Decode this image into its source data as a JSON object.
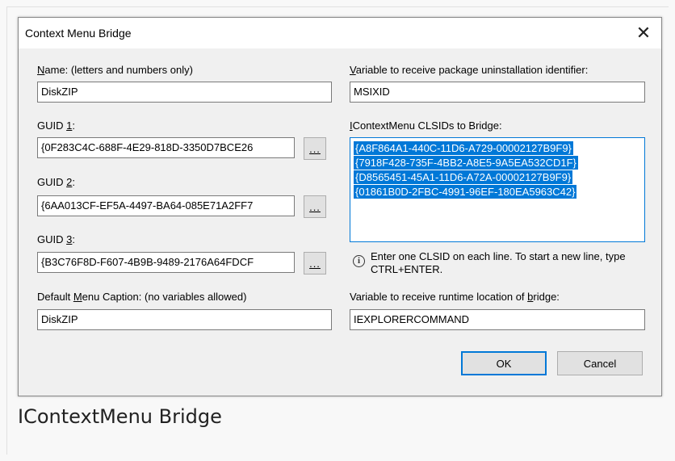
{
  "dialog": {
    "title": "Context Menu Bridge",
    "close_glyph": "✕"
  },
  "name_field": {
    "label_pre": "",
    "label_access": "N",
    "label_post": "ame: (letters and numbers only)",
    "value": "DiskZIP"
  },
  "variable_uninstall": {
    "label_pre": "",
    "label_access": "V",
    "label_post": "ariable to receive package uninstallation identifier:",
    "value": "MSIXID"
  },
  "guid1": {
    "label_pre": "GUID ",
    "label_access": "1",
    "label_post": ":",
    "value": "{0F283C4C-688F-4E29-818D-3350D7BCE26"
  },
  "guid2": {
    "label_pre": "GUID ",
    "label_access": "2",
    "label_post": ":",
    "value": "{6AA013CF-EF5A-4497-BA64-085E71A2FF7"
  },
  "guid3": {
    "label_pre": "GUID ",
    "label_access": "3",
    "label_post": ":",
    "value": "{B3C76F8D-F607-4B9B-9489-2176A64FDCF"
  },
  "browse_label": "...",
  "clsids": {
    "label_pre": "",
    "label_access": "I",
    "label_post": "ContextMenu CLSIDs to Bridge:",
    "lines": [
      "{A8F864A1-440C-11D6-A729-00002127B9F9}",
      "{7918F428-735F-4BB2-A8E5-9A5EA532CD1F}",
      "{D8565451-45A1-11D6-A72A-00002127B9F9}",
      "{01861B0D-2FBC-4991-96EF-180EA5963C42}"
    ]
  },
  "hint": {
    "icon": "info-icon",
    "text": "Enter one CLSID on each line. To start a new line, type CTRL+ENTER."
  },
  "menu_caption": {
    "label_pre": "Default ",
    "label_access": "M",
    "label_post": "enu Caption: (no variables allowed)",
    "value": "DiskZIP"
  },
  "runtime_location": {
    "label_pre": "Variable to receive runtime location of ",
    "label_access": "b",
    "label_post": "ridge:",
    "value": "IEXPLORERCOMMAND"
  },
  "buttons": {
    "ok": "OK",
    "cancel": "Cancel"
  },
  "page_caption": "IContextMenu Bridge",
  "colors": {
    "selection": "#0078d7",
    "dialog_bg": "#f0f0f0"
  }
}
